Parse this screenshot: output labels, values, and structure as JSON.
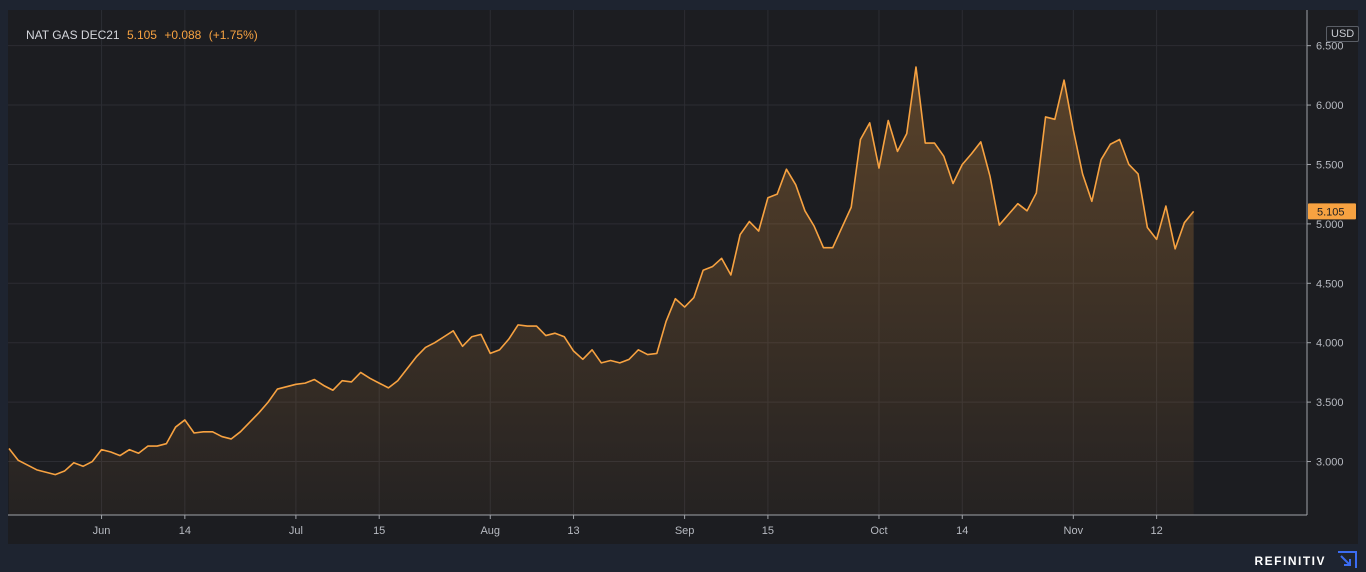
{
  "header": {
    "instrument": "NAT GAS DEC21",
    "last_price": "5.105",
    "change": "+0.088",
    "change_pct": "(+1.75%)"
  },
  "currency_badge": "USD",
  "last_price_tag": "5.105",
  "brand": "REFINITIV",
  "colors": {
    "line": "#f7a241",
    "background": "#1c1d21",
    "grid": "#2c2d33",
    "axis": "#a0a3a9",
    "tag": "#f7a241"
  },
  "chart_data": {
    "type": "area",
    "ylim": [
      2.55,
      6.8
    ],
    "y_ticks": [
      3.0,
      3.5,
      4.0,
      4.5,
      5.0,
      5.5,
      6.0,
      6.5
    ],
    "y_tick_labels": [
      "3.000",
      "3.500",
      "4.000",
      "4.500",
      "5.000",
      "5.500",
      "6.000",
      "6.500"
    ],
    "x_ticks": [
      {
        "label": "Jun",
        "index": 10
      },
      {
        "label": "14",
        "index": 19
      },
      {
        "label": "Jul",
        "index": 31
      },
      {
        "label": "15",
        "index": 40
      },
      {
        "label": "Aug",
        "index": 52
      },
      {
        "label": "13",
        "index": 61
      },
      {
        "label": "Sep",
        "index": 73
      },
      {
        "label": "15",
        "index": 82
      },
      {
        "label": "Oct",
        "index": 94
      },
      {
        "label": "14",
        "index": 103
      },
      {
        "label": "Nov",
        "index": 115
      },
      {
        "label": "12",
        "index": 124
      }
    ],
    "grid": true,
    "series": [
      {
        "values": [
          3.11,
          3.01,
          2.97,
          2.93,
          2.91,
          2.89,
          2.92,
          2.99,
          2.96,
          3.0,
          3.1,
          3.08,
          3.05,
          3.1,
          3.07,
          3.13,
          3.13,
          3.15,
          3.29,
          3.35,
          3.24,
          3.25,
          3.25,
          3.21,
          3.19,
          3.25,
          3.33,
          3.41,
          3.5,
          3.61,
          3.63,
          3.65,
          3.66,
          3.69,
          3.64,
          3.6,
          3.68,
          3.67,
          3.75,
          3.7,
          3.66,
          3.62,
          3.68,
          3.78,
          3.88,
          3.96,
          4.0,
          4.05,
          4.1,
          3.97,
          4.05,
          4.07,
          3.91,
          3.94,
          4.03,
          4.15,
          4.14,
          4.14,
          4.06,
          4.08,
          4.05,
          3.93,
          3.86,
          3.94,
          3.83,
          3.85,
          3.83,
          3.86,
          3.94,
          3.9,
          3.91,
          4.18,
          4.37,
          4.3,
          4.38,
          4.61,
          4.64,
          4.71,
          4.57,
          4.91,
          5.02,
          4.94,
          5.22,
          5.25,
          5.46,
          5.33,
          5.11,
          4.98,
          4.8,
          4.8,
          4.97,
          5.14,
          5.71,
          5.85,
          5.47,
          5.87,
          5.61,
          5.76,
          6.32,
          5.68,
          5.68,
          5.57,
          5.34,
          5.5,
          5.59,
          5.69,
          5.4,
          4.99,
          5.08,
          5.17,
          5.11,
          5.26,
          5.9,
          5.88,
          6.21,
          5.79,
          5.42,
          5.19,
          5.54,
          5.67,
          5.71,
          5.5,
          5.42,
          4.97,
          4.87,
          5.15,
          4.79,
          5.01,
          5.105
        ]
      }
    ]
  }
}
